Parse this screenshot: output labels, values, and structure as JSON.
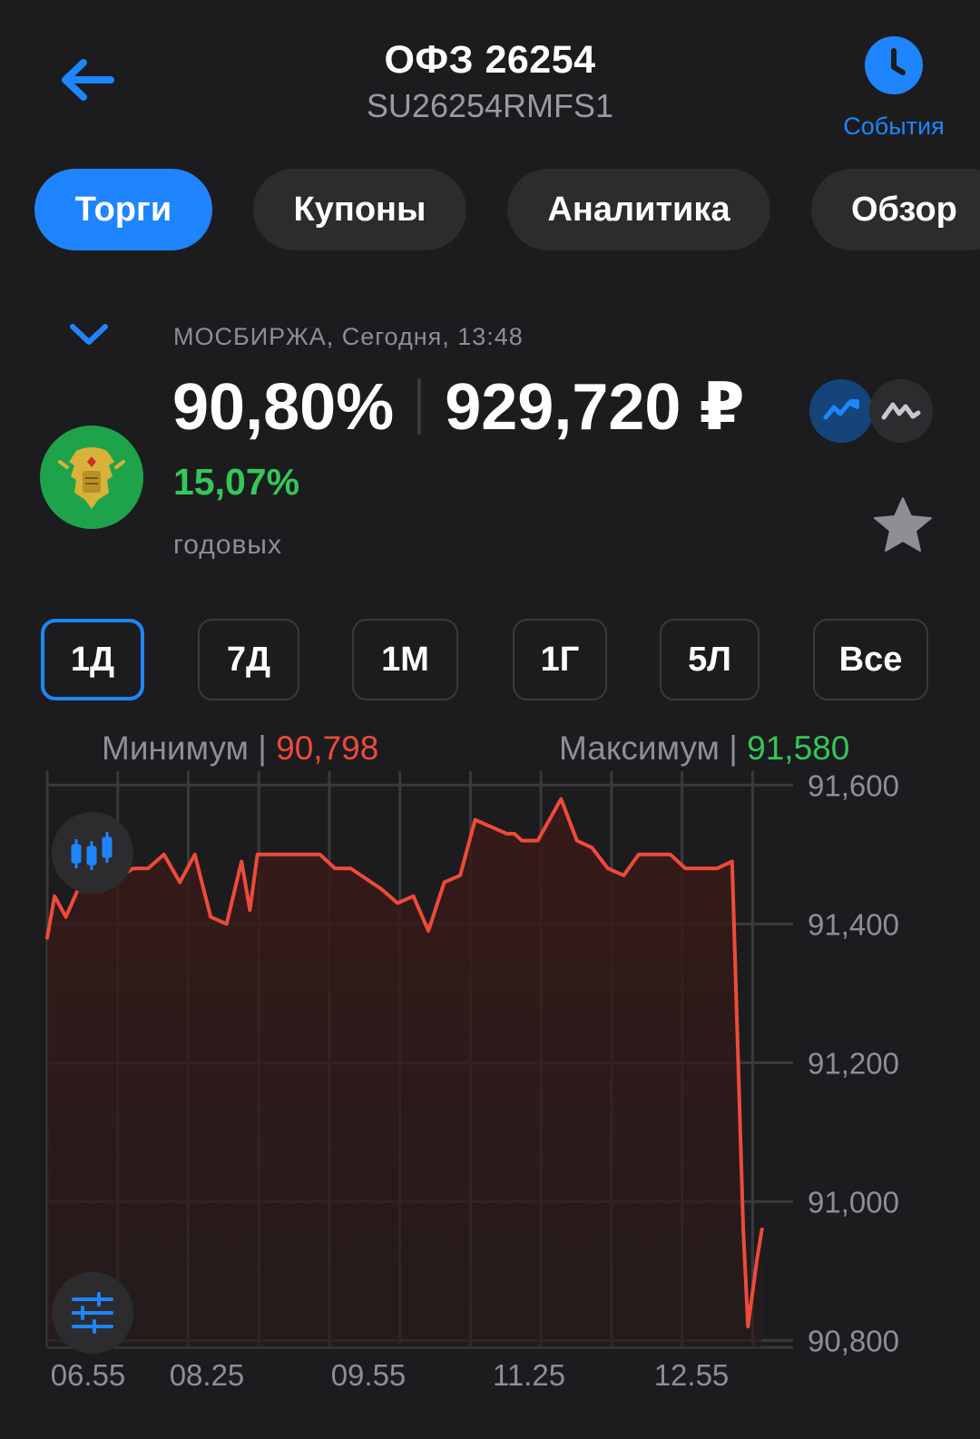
{
  "header": {
    "title": "ОФЗ 26254",
    "subtitle": "SU26254RMFS1",
    "events_label": "События"
  },
  "tabs": [
    {
      "label": "Торги",
      "active": true
    },
    {
      "label": "Купоны",
      "active": false
    },
    {
      "label": "Аналитика",
      "active": false
    },
    {
      "label": "Обзор",
      "active": false
    }
  ],
  "quote": {
    "exchange_line": "МОСБИРЖА, Сегодня, 13:48",
    "price_percent": "90,80%",
    "price_rub": "929,720 ₽",
    "yield": "15,07%",
    "yield_label": "годовых"
  },
  "periods": [
    {
      "label": "1Д",
      "active": true
    },
    {
      "label": "7Д",
      "active": false
    },
    {
      "label": "1М",
      "active": false
    },
    {
      "label": "1Г",
      "active": false
    },
    {
      "label": "5Л",
      "active": false
    },
    {
      "label": "Все",
      "active": false
    }
  ],
  "stats": {
    "min_label": "Минимум",
    "min_value": "90,798",
    "max_label": "Максимум",
    "max_value": "91,580",
    "divider": "|"
  },
  "colors": {
    "accent": "#1f85ff",
    "line": "#ef4a3a",
    "positive": "#34c759",
    "negative": "#ef4a3a",
    "background": "#1c1c1e"
  },
  "icons": {
    "back": "arrow-left-icon",
    "events": "clock-icon",
    "collapse": "chevron-down-icon",
    "issuer": "emblem-logo",
    "line_mode": "line-chart-icon",
    "area_mode": "area-chart-icon",
    "favorite": "star-icon",
    "candles": "candlestick-icon",
    "settings": "sliders-icon"
  },
  "chart_data": {
    "type": "line",
    "x_ticks": [
      "06.55",
      "08.25",
      "09.55",
      "11.25",
      "12.55"
    ],
    "y_ticks": [
      "91,600",
      "91,400",
      "91,200",
      "91,000",
      "90,800"
    ],
    "ylim": [
      90.79,
      91.62
    ],
    "grid": true,
    "series": [
      {
        "x": [
          6.0,
          6.08,
          6.2,
          6.33,
          6.5,
          6.67,
          6.92,
          7.08,
          7.25,
          7.42,
          7.58,
          7.75,
          7.92,
          8.08,
          8.17,
          8.25,
          8.33,
          8.42,
          8.5,
          8.58,
          8.75,
          8.92,
          9.08,
          9.25,
          9.58,
          9.75,
          9.92,
          10.08,
          10.25,
          10.42,
          10.58,
          10.75,
          10.92,
          11.0,
          11.08,
          11.25,
          11.5,
          11.67,
          11.83,
          12.0,
          12.17,
          12.33,
          12.5,
          12.67,
          12.83,
          13.0,
          13.17,
          13.33,
          13.45,
          13.5,
          13.54,
          13.6,
          13.65
        ],
        "y": [
          91.38,
          91.44,
          91.41,
          91.45,
          91.45,
          91.46,
          91.48,
          91.48,
          91.5,
          91.46,
          91.5,
          91.41,
          91.4,
          91.49,
          91.42,
          91.5,
          91.5,
          91.5,
          91.5,
          91.5,
          91.5,
          91.5,
          91.48,
          91.48,
          91.45,
          91.43,
          91.44,
          91.39,
          91.46,
          91.47,
          91.55,
          91.54,
          91.53,
          91.53,
          91.52,
          91.52,
          91.58,
          91.52,
          91.51,
          91.48,
          91.47,
          91.5,
          91.5,
          91.5,
          91.48,
          91.48,
          91.48,
          91.49,
          90.96,
          90.82,
          90.86,
          90.92,
          90.96
        ]
      }
    ]
  }
}
